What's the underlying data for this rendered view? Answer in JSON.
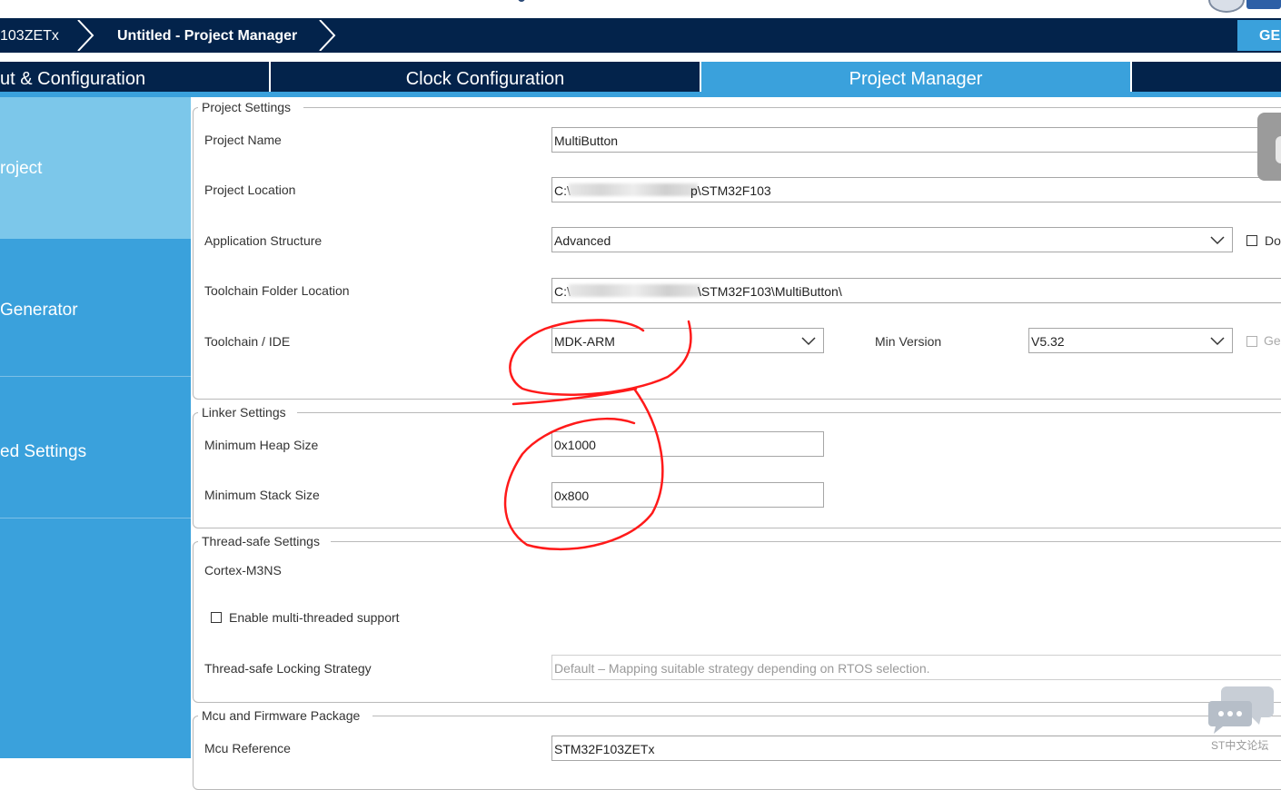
{
  "breadcrumb": {
    "chip_label": "103ZETx",
    "title": "Untitled - Project Manager",
    "generate_label": "GE"
  },
  "tabs": [
    {
      "label": "ut & Configuration",
      "active": false
    },
    {
      "label": "Clock Configuration",
      "active": false
    },
    {
      "label": "Project Manager",
      "active": true
    }
  ],
  "sidebar": {
    "items": [
      {
        "label": "roject",
        "active": true
      },
      {
        "label": "Generator",
        "active": false
      },
      {
        "label": "ed Settings",
        "active": false
      }
    ]
  },
  "project_settings": {
    "legend": "Project Settings",
    "project_name": {
      "label": "Project Name",
      "value": "MultiButton"
    },
    "project_location": {
      "label": "Project Location",
      "prefix": "C:\\",
      "suffix": "p\\STM32F103"
    },
    "application_structure": {
      "label": "Application Structure",
      "value": "Advanced",
      "checkbox_label": "Do"
    },
    "toolchain_folder": {
      "label": "Toolchain Folder Location",
      "prefix": "C:\\",
      "suffix": "\\STM32F103\\MultiButton\\"
    },
    "toolchain_ide": {
      "label": "Toolchain / IDE",
      "value": "MDK-ARM"
    },
    "min_version": {
      "label": "Min Version",
      "value": "V5.32",
      "checkbox_label": "Ge"
    }
  },
  "linker_settings": {
    "legend": "Linker Settings",
    "heap": {
      "label": "Minimum Heap Size",
      "value": "0x1000"
    },
    "stack": {
      "label": "Minimum Stack Size",
      "value": "0x800"
    }
  },
  "thread_safe": {
    "legend": "Thread-safe Settings",
    "core": "Cortex-M3NS",
    "multithread_label": "Enable multi-threaded support",
    "locking": {
      "label": "Thread-safe Locking Strategy",
      "value": "Default – Mapping suitable strategy depending on RTOS selection."
    }
  },
  "mcu_package": {
    "legend": "Mcu and Firmware Package",
    "reference": {
      "label": "Mcu Reference",
      "value": "STM32F103ZETx"
    }
  },
  "watermark": {
    "text": "ST中文论坛"
  },
  "colors": {
    "navy": "#03234b",
    "accent_blue": "#3aa1dc",
    "active_sidebar": "#7cc7ea",
    "annotation_red": "#ff1a1a"
  }
}
